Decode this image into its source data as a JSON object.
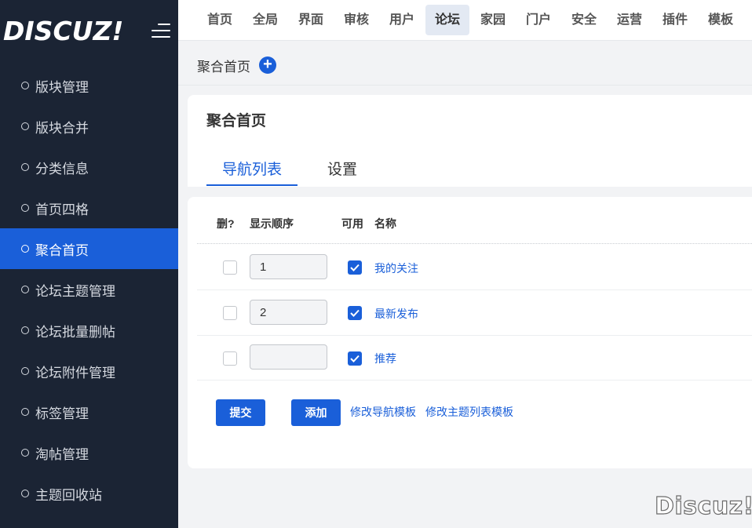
{
  "sidebar": {
    "logo": "DISCUZ!",
    "items": [
      {
        "label": "版块管理"
      },
      {
        "label": "版块合并"
      },
      {
        "label": "分类信息"
      },
      {
        "label": "首页四格"
      },
      {
        "label": "聚合首页",
        "active": true
      },
      {
        "label": "论坛主题管理"
      },
      {
        "label": "论坛批量删帖"
      },
      {
        "label": "论坛附件管理"
      },
      {
        "label": "标签管理"
      },
      {
        "label": "淘帖管理"
      },
      {
        "label": "主题回收站"
      }
    ]
  },
  "topnav": {
    "tabs": [
      {
        "label": "首页"
      },
      {
        "label": "全局"
      },
      {
        "label": "界面"
      },
      {
        "label": "审核"
      },
      {
        "label": "用户"
      },
      {
        "label": "论坛",
        "active": true
      },
      {
        "label": "家园"
      },
      {
        "label": "门户"
      },
      {
        "label": "安全"
      },
      {
        "label": "运营"
      },
      {
        "label": "插件"
      },
      {
        "label": "模板"
      }
    ]
  },
  "subheader": {
    "title": "聚合首页",
    "add_icon": "plus-icon"
  },
  "card": {
    "title": "聚合首页",
    "tabs": [
      {
        "label": "导航列表",
        "active": true
      },
      {
        "label": "设置"
      }
    ]
  },
  "table": {
    "headers": {
      "del": "删?",
      "order": "显示顺序",
      "enabled": "可用",
      "name": "名称"
    },
    "rows": [
      {
        "order": "1",
        "enabled": true,
        "name": "我的关注"
      },
      {
        "order": "2",
        "enabled": true,
        "name": "最新发布"
      },
      {
        "order": "",
        "enabled": true,
        "name": "推荐"
      }
    ]
  },
  "actions": {
    "submit": "提交",
    "add": "添加",
    "edit_nav_template": "修改导航模板",
    "edit_thread_template": "修改主题列表模板"
  },
  "watermark": "Discuz!",
  "colors": {
    "accent": "#1a5fd9",
    "sidebar_bg": "#1b2434",
    "page_bg": "#f2f3f5"
  }
}
